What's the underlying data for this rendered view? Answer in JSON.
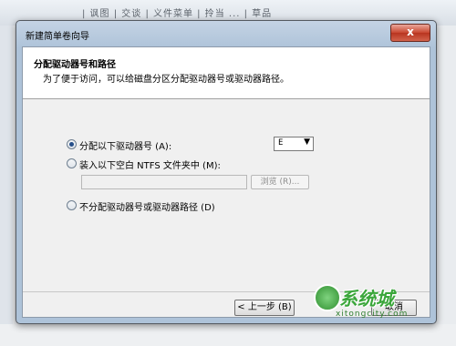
{
  "background": {
    "strip_text": "| 讽图 | 交谈 | 义件菜单 | 拎当 ...                    | 草品"
  },
  "window": {
    "title": "新建简单卷向导",
    "close_glyph": "x"
  },
  "header": {
    "title": "分配驱动器号和路径",
    "subtitle": "为了便于访问，可以给磁盘分区分配驱动器号或驱动器路径。"
  },
  "options": {
    "assign_letter_label": "分配以下驱动器号 (A):",
    "assign_letter_selected": true,
    "drive_letter_value": "E",
    "mount_folder_label": "装入以下空白 NTFS 文件夹中 (M):",
    "mount_folder_path": "",
    "browse_label": "浏览 (R)...",
    "no_assign_label": "不分配驱动器号或驱动器路径 (D)"
  },
  "footer": {
    "back_label": "< 上一步 (B)",
    "cancel_label": "取消"
  },
  "watermark": {
    "brand": "系统城",
    "url": "xitongcity.com"
  },
  "colors": {
    "accent": "#264f8a",
    "close_button": "#c9462f",
    "watermark": "#3aa63a"
  }
}
